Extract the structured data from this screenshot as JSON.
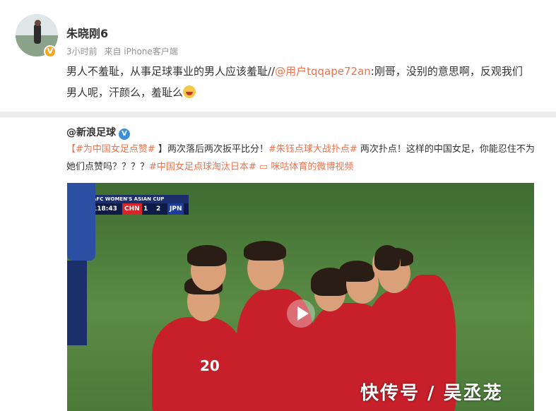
{
  "post": {
    "username": "朱晓刚6",
    "time": "3小时前",
    "source": "来自 iPhone客户端",
    "text_before": "男人不羞耻，从事足球事业的男人应该羞耻//",
    "mention": "@用户tqqape72an",
    "text_after": ":刚哥，没别的意思啊，反观我们男人呢，汗颜么，羞耻么",
    "emoji": "crying-face"
  },
  "repost": {
    "author": "@新浪足球",
    "topic1": "【#为中国女足点赞#",
    "topic1_close": " 】",
    "text1": "两次落后两次扳平比分！",
    "topic2": "#朱钰点球大战扑点#",
    "text2": " 两次扑点！这样的中国女足，你能忍住不为她们点赞吗？？？？",
    "topic3": "#中国女足点球淘汰日本#",
    "video_link": "咪咕体育的微博视频"
  },
  "video": {
    "scoreboard_title": "AFC WOMEN'S ASIAN CUP",
    "time": "118:43",
    "team1": "CHN",
    "score1": "1",
    "score2": "2",
    "team2": "JPN",
    "jersey_number": "20",
    "watermark": "快传号 / 吴丞茏"
  },
  "colors": {
    "accent": "#eb7350",
    "verified": "#f5a623",
    "blue_badge": "#3b8fd9",
    "chn_red": "#d7262a",
    "jpn_blue": "#1f3c9a"
  }
}
